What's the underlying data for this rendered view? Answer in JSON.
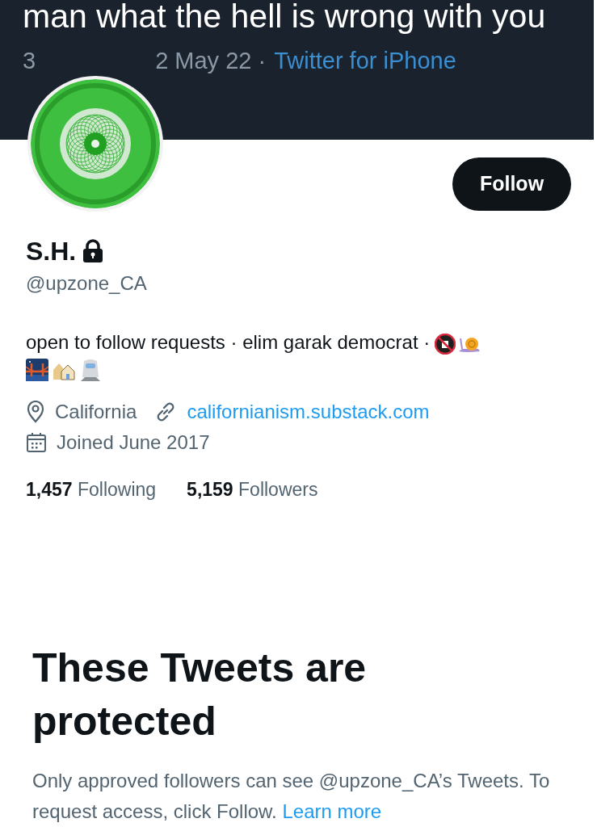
{
  "banner": {
    "tweet_text": "man what the hell is wrong with you",
    "meta_start": "3",
    "meta_date": "2 May 22 ·",
    "source": "Twitter for iPhone"
  },
  "follow_button": "Follow",
  "profile": {
    "name": "S.H.",
    "locked": true,
    "handle": "@upzone_CA",
    "bio": "open to follow requests · elim garak democrat ·",
    "location": "California",
    "website": "californianism.substack.com",
    "joined": "Joined June 2017"
  },
  "stats": [
    {
      "count": "1,457",
      "label": "Following"
    },
    {
      "count": "5,159",
      "label": "Followers"
    }
  ],
  "protected": {
    "heading": "These Tweets are protected",
    "message": "Only approved followers can see @upzone_CA’s Tweets. To request access, click Follow.",
    "link": "Learn more"
  }
}
